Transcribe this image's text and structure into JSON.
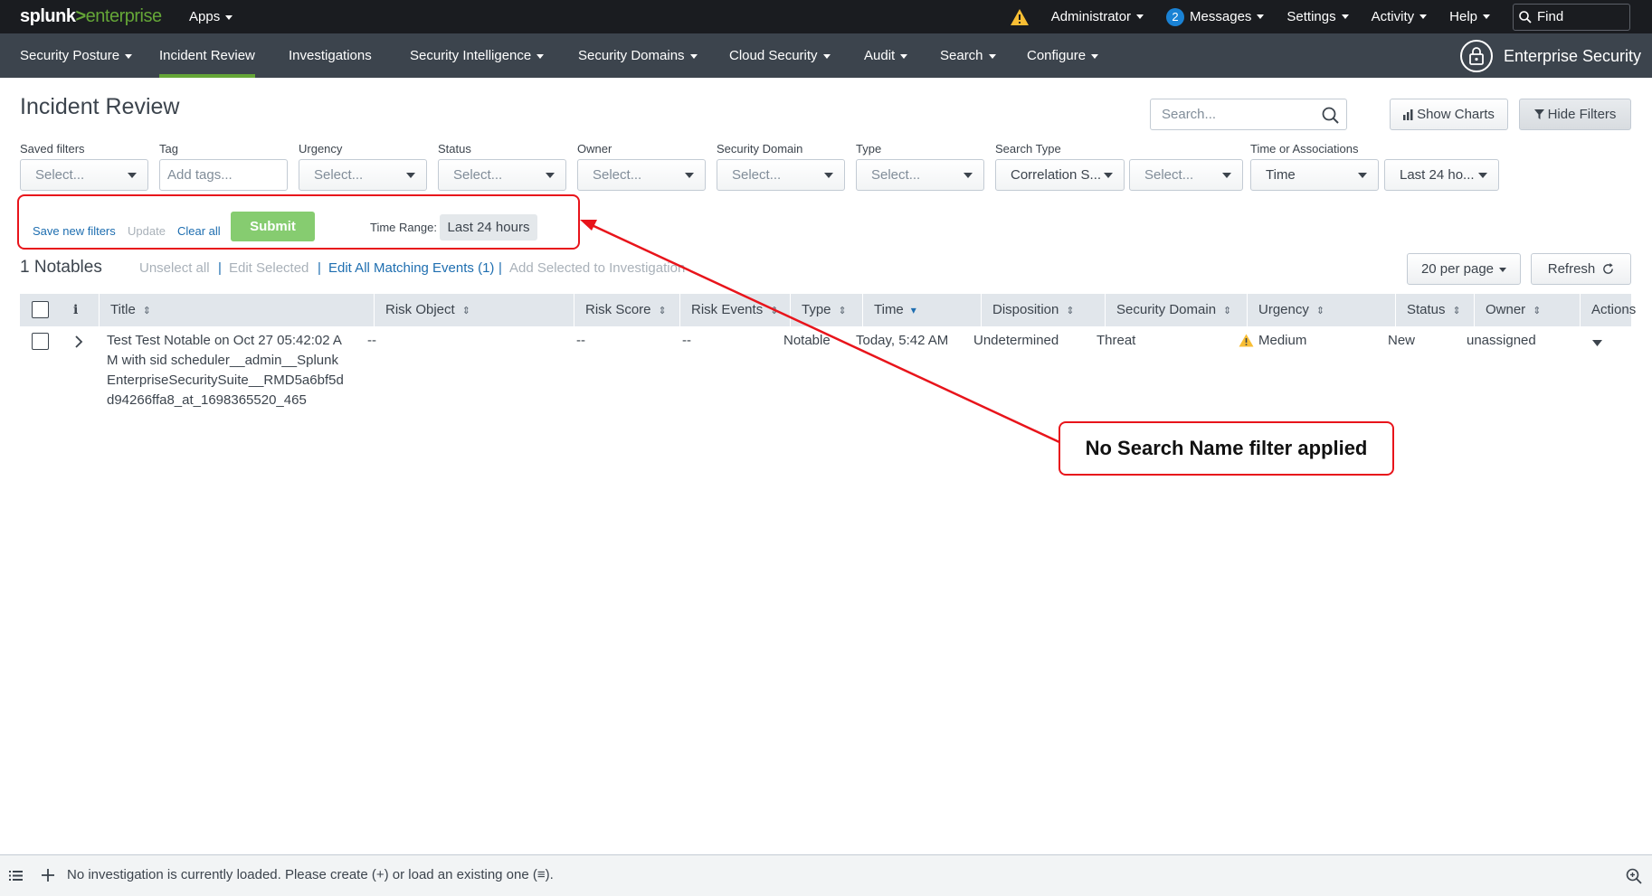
{
  "topbar": {
    "logo_main": "splunk",
    "logo_gt": ">",
    "logo_product": "enterprise",
    "apps_label": "Apps",
    "user_label": "Administrator",
    "messages_count": "2",
    "messages_label": "Messages",
    "settings_label": "Settings",
    "activity_label": "Activity",
    "help_label": "Help",
    "find_placeholder": "Find"
  },
  "appnav": {
    "items": [
      {
        "label": "Security Posture"
      },
      {
        "label": "Incident Review"
      },
      {
        "label": "Investigations"
      },
      {
        "label": "Security Intelligence"
      },
      {
        "label": "Security Domains"
      },
      {
        "label": "Cloud Security"
      },
      {
        "label": "Audit"
      },
      {
        "label": "Search"
      },
      {
        "label": "Configure"
      }
    ],
    "brand": "Enterprise Security"
  },
  "page": {
    "title": "Incident Review",
    "search_placeholder": "Search...",
    "show_charts": "Show Charts",
    "hide_filters": "Hide Filters"
  },
  "filters": {
    "saved_filters": {
      "label": "Saved filters",
      "value": "Select..."
    },
    "tag": {
      "label": "Tag",
      "placeholder": "Add tags..."
    },
    "urgency": {
      "label": "Urgency",
      "value": "Select..."
    },
    "status": {
      "label": "Status",
      "value": "Select..."
    },
    "owner": {
      "label": "Owner",
      "value": "Select..."
    },
    "security_domain": {
      "label": "Security Domain",
      "value": "Select..."
    },
    "type": {
      "label": "Type",
      "value": "Select..."
    },
    "search_type": {
      "label": "Search Type",
      "value": "Correlation S...",
      "value2": "Select..."
    },
    "time_assoc": {
      "label": "Time or Associations",
      "value": "Time",
      "value2": "Last 24 ho..."
    }
  },
  "actions": {
    "save_new_filters": "Save new filters",
    "update": "Update",
    "clear_all": "Clear all",
    "submit": "Submit",
    "time_range_label": "Time Range:",
    "time_range_value": "Last 24 hours"
  },
  "annotation": {
    "text": "No Search Name filter applied",
    "color": "#e8141b"
  },
  "notables": {
    "count_label": "1 Notables",
    "unselect_all": "Unselect all",
    "edit_selected": "Edit Selected",
    "edit_all_matching": "Edit All Matching Events (1)",
    "add_to_investigation": "Add Selected to Investigation",
    "per_page": "20 per page",
    "refresh": "Refresh"
  },
  "table": {
    "columns": [
      "i",
      "Title",
      "Risk Object",
      "Risk Score",
      "Risk Events",
      "Type",
      "Time",
      "Disposition",
      "Security Domain",
      "Urgency",
      "Status",
      "Owner",
      "Actions"
    ],
    "rows": [
      {
        "title": "Test Test Notable on Oct 27 05:42:02 AM with sid scheduler__admin__SplunkEnterpriseSecuritySuite__RMD5a6bf5dd94266ffa8_at_1698365520_465",
        "risk_object": "--",
        "risk_score": "--",
        "risk_events": "--",
        "type": "Notable",
        "time": "Today, 5:42 AM",
        "disposition": "Undetermined",
        "security_domain": "Threat",
        "urgency": "Medium",
        "status": "New",
        "owner": "unassigned"
      }
    ]
  },
  "bottombar": {
    "text": "No investigation is currently loaded. Please create (+) or load an existing one (≡)."
  },
  "colors": {
    "topbar_bg": "#1a1c20",
    "nav_bg": "#3c444d",
    "accent_green": "#65a637",
    "link_blue": "#1e6eb0",
    "urgency_medium": "#f8be34"
  }
}
